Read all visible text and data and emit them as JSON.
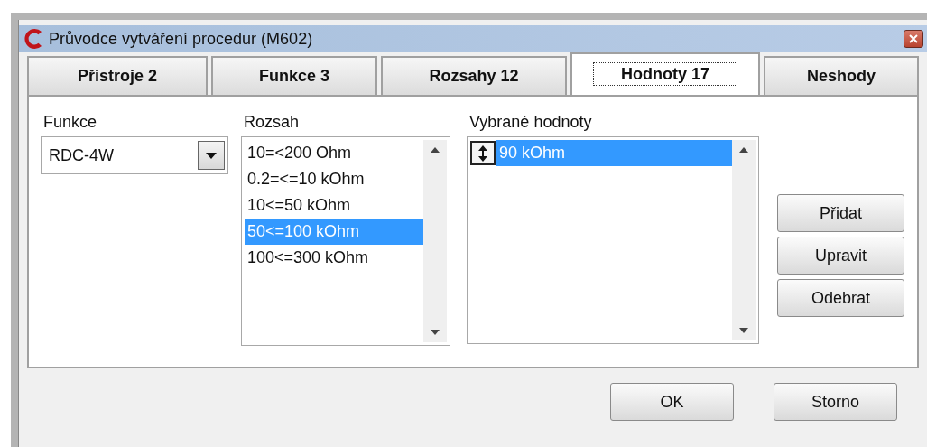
{
  "window": {
    "title": "Průvodce vytváření procedur (M602)"
  },
  "tabs": [
    {
      "label": "Přistroje 2",
      "selected": false
    },
    {
      "label": "Funkce 3",
      "selected": false
    },
    {
      "label": "Rozsahy 12",
      "selected": false
    },
    {
      "label": "Hodnoty 17",
      "selected": true
    },
    {
      "label": "Neshody",
      "selected": false
    }
  ],
  "function_field": {
    "label": "Funkce",
    "value": "RDC-4W"
  },
  "range_list": {
    "label": "Rozsah",
    "items": [
      {
        "text": "10=<200 Ohm",
        "selected": false
      },
      {
        "text": "0.2=<=10 kOhm",
        "selected": false
      },
      {
        "text": "10<=50 kOhm",
        "selected": false
      },
      {
        "text": "50<=100 kOhm",
        "selected": true
      },
      {
        "text": "100<=300 kOhm",
        "selected": false
      }
    ]
  },
  "values_list": {
    "label": "Vybrané hodnoty",
    "items": [
      {
        "text": "90 kOhm",
        "selected": true
      }
    ]
  },
  "side_buttons": [
    "Přidat",
    "Upravit",
    "Odebrat"
  ],
  "buttons": [
    "OK",
    "Storno"
  ]
}
